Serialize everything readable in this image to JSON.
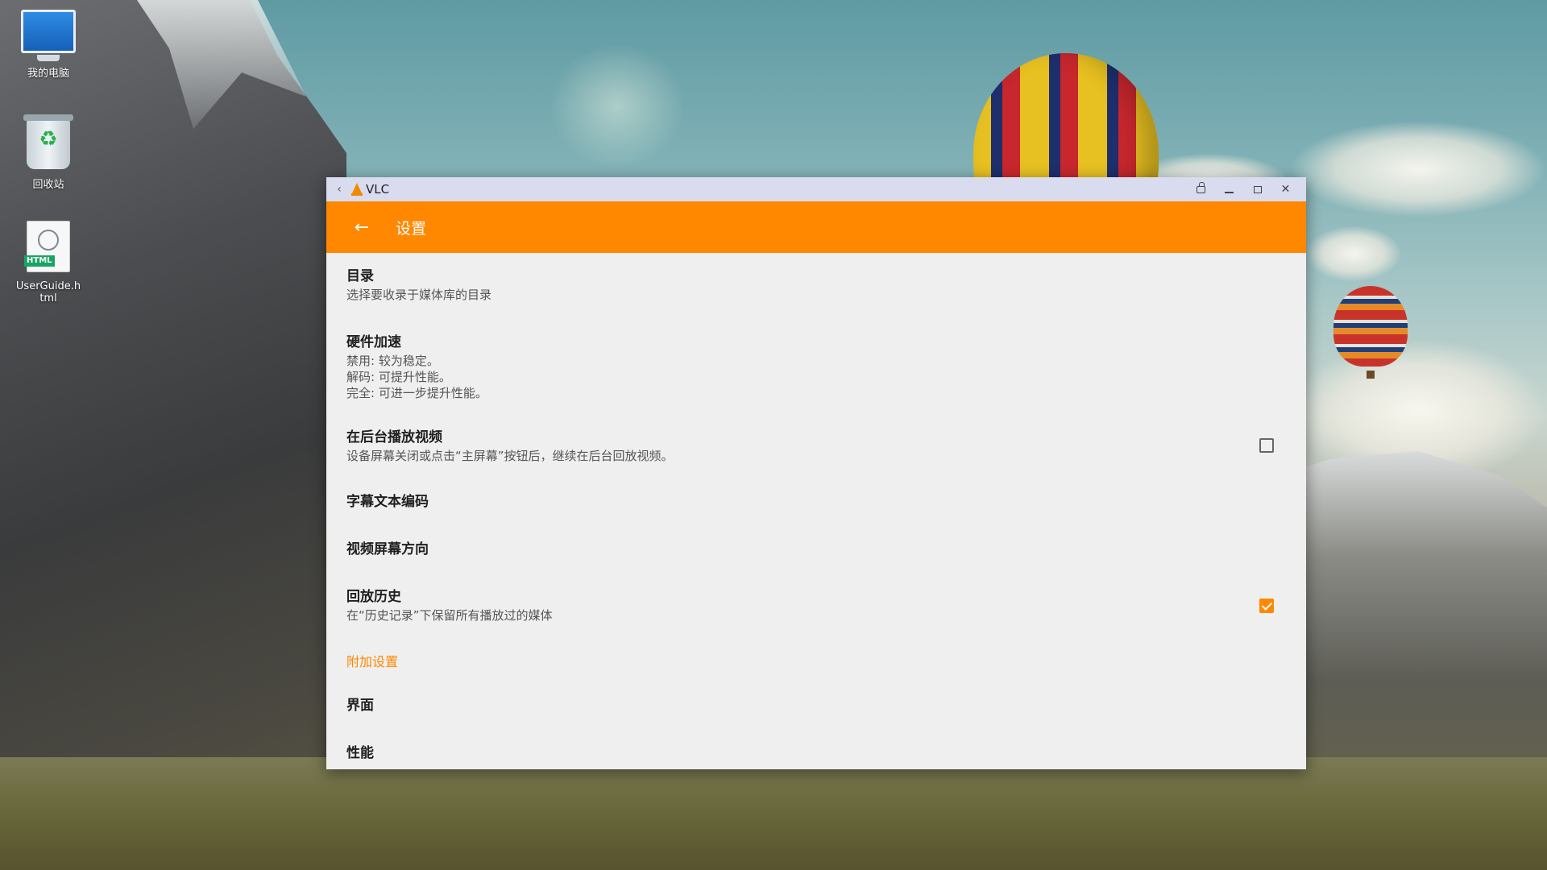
{
  "desktop": {
    "icons": [
      {
        "label": "我的电脑",
        "icon": "computer-icon"
      },
      {
        "label": "回收站",
        "icon": "recycle-bin-icon"
      },
      {
        "label": "UserGuide.h\ntml",
        "icon": "html-file-icon",
        "badge": "HTML"
      }
    ]
  },
  "window": {
    "title": "VLC",
    "icons": {
      "back": "back-icon",
      "app": "vlc-icon",
      "rotate": "rotate-icon",
      "minimize": "minimize-icon",
      "maximize": "maximize-icon",
      "close": "close-icon"
    },
    "close_glyph": "✕",
    "back_glyph": "‹"
  },
  "appbar": {
    "title": "设置",
    "back_glyph": "←",
    "color": "#ff8800"
  },
  "settings": {
    "directories": {
      "title": "目录",
      "summary": "选择要收录于媒体库的目录"
    },
    "hw_accel": {
      "title": "硬件加速",
      "summary": "禁用: 较为稳定。\n解码: 可提升性能。\n完全: 可进一步提升性能。"
    },
    "background_play": {
      "title": "在后台播放视频",
      "summary": "设备屏幕关闭或点击“主屏幕”按钮后，继续在后台回放视频。",
      "checked": false
    },
    "subtitle_encoding": {
      "title": "字幕文本编码"
    },
    "screen_orientation": {
      "title": "视频屏幕方向"
    },
    "playback_history": {
      "title": "回放历史",
      "summary": "在“历史记录”下保留所有播放过的媒体",
      "checked": true
    },
    "extra_category": "附加设置",
    "interface": {
      "title": "界面"
    },
    "performance": {
      "title": "性能"
    }
  }
}
